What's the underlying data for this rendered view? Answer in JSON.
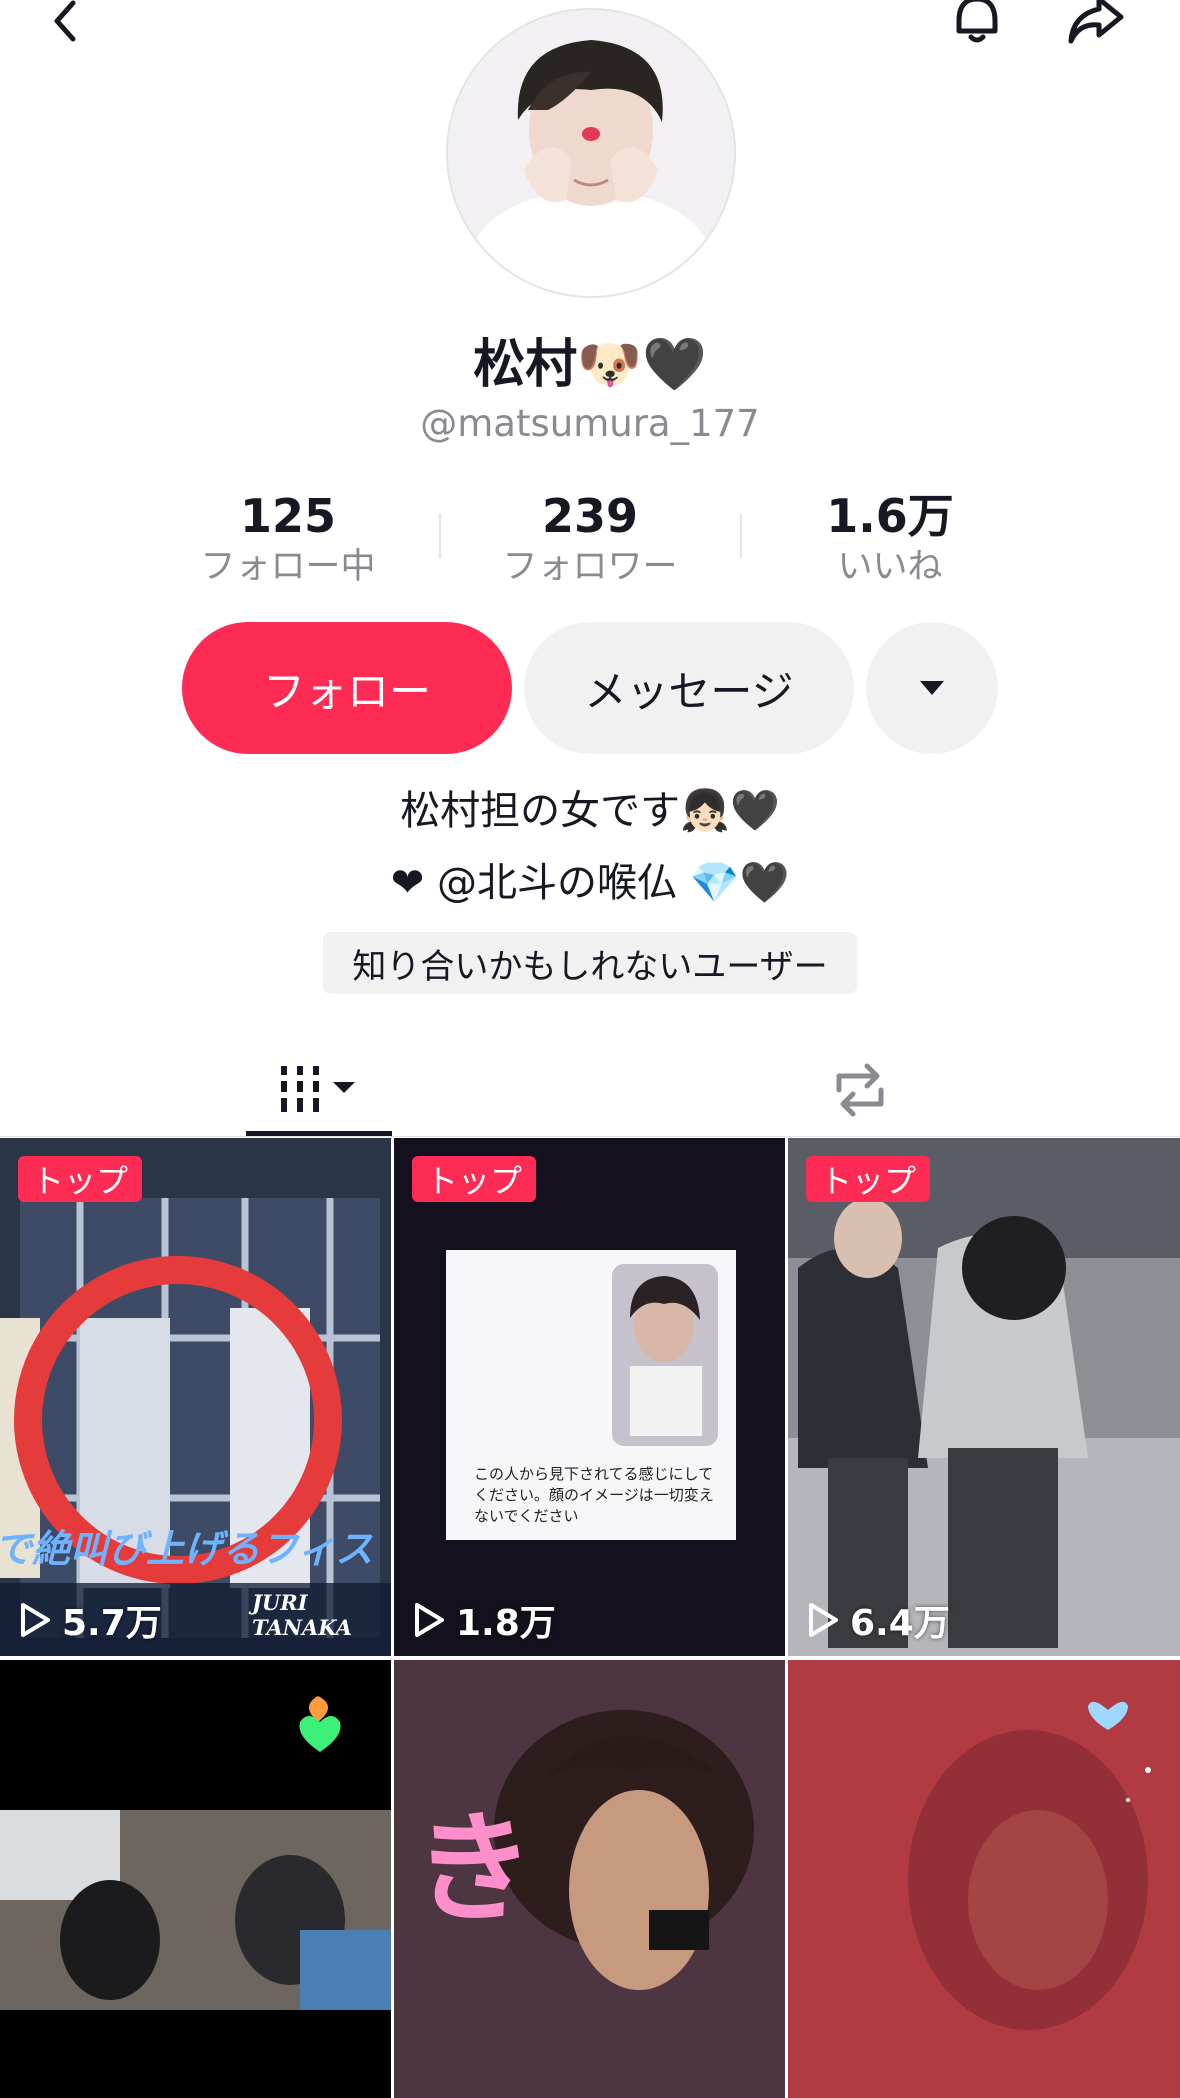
{
  "profile": {
    "display_name": "松村🐶🖤",
    "username": "@matsumura_177",
    "stats": [
      {
        "value": "125",
        "label": "フォロー中"
      },
      {
        "value": "239",
        "label": "フォロワー"
      },
      {
        "value": "1.6万",
        "label": "いいね"
      }
    ],
    "follow_label": "フォロー",
    "message_label": "メッセージ",
    "bio_lines": [
      "松村担の女です👧🏻🖤",
      "❤ @北斗の喉仏 💎🖤"
    ],
    "suggested_tag": "知り合いかもしれないユーザー"
  },
  "videos": [
    {
      "badge": "トップ",
      "views": "5.7万",
      "caption": "で絶叫び上げるフィス",
      "credit": "JURI TANAKA"
    },
    {
      "badge": "トップ",
      "views": "1.8万",
      "caption": "この人から見下されてる感じにしてください。顔のイメージは一切変えないでください"
    },
    {
      "badge": "トップ",
      "views": "6.4万"
    },
    {},
    {},
    {}
  ],
  "colors": {
    "accent": "#fe2c55",
    "text": "#161823",
    "muted": "#8a8b91",
    "button_bg": "#f1f1f2"
  }
}
